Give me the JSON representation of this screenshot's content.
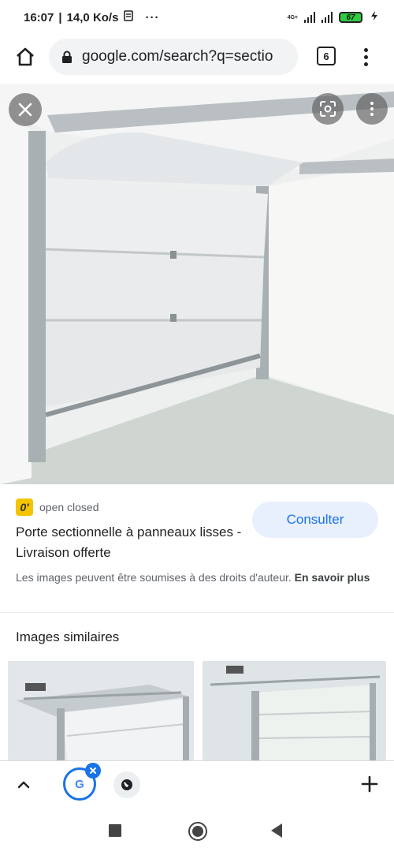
{
  "status_bar": {
    "time": "16:07",
    "speed": "14,0 Ko/s",
    "overflow": "···",
    "network_type": "4G+",
    "battery_level": "67",
    "icons": [
      "sim-card-icon",
      "signal-icon",
      "wifi-signal-icon",
      "battery-icon",
      "charging-icon"
    ]
  },
  "browser": {
    "url": "google.com/search?q=sectio",
    "tab_count": "6",
    "icons": [
      "home-icon",
      "lock-icon",
      "menu-icon"
    ]
  },
  "image_viewer": {
    "icons": [
      "close-icon",
      "google-lens-icon",
      "more-vert-icon"
    ]
  },
  "result": {
    "source_name": "open closed",
    "source_favicon_text": "0'",
    "title": "Porte sectionnelle à panneaux lisses - Livraison offerte",
    "action_label": "Consulter",
    "copyright_notice": "Les images peuvent être soumises à des droits d'auteur.",
    "learn_more": "En savoir plus"
  },
  "similar": {
    "title": "Images similaires"
  },
  "bottom_toolbar": {
    "google_tab_letter": "G",
    "icons": [
      "chevron-up-icon",
      "google-tab-icon",
      "close-badge-icon",
      "globe-icon",
      "plus-icon"
    ]
  },
  "colors": {
    "accent_blue": "#1a73e8",
    "consult_bg": "#e8f0fe",
    "battery_green": "#2ecc40",
    "favicon_yellow": "#f5c400"
  }
}
